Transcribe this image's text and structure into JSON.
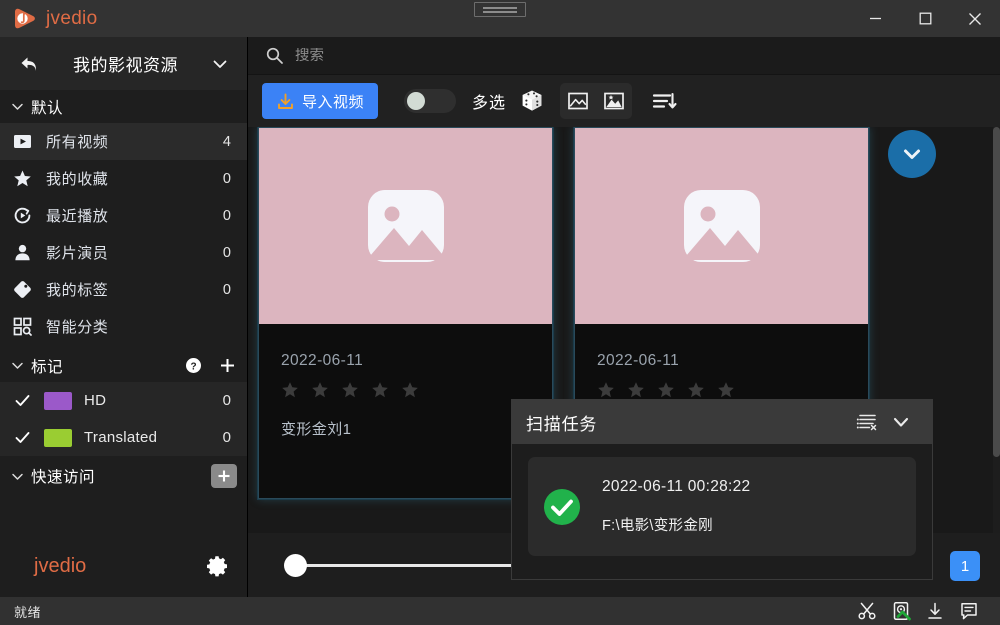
{
  "window": {
    "app_name": "jvedio",
    "logo_icon": "jvedio-play-logo-icon",
    "drag_handle_icon": "window-drag-handle-icon",
    "minimize_label": "–",
    "maximize_icon": "maximize-square-icon",
    "close_label": "✕"
  },
  "sidebar": {
    "back_icon": "back-arrow-icon",
    "title": "我的影视资源",
    "caret_icon": "chevron-down-icon",
    "default_group": {
      "label": "默认",
      "chevron_icon": "chevron-down-icon"
    },
    "items": [
      {
        "label": "所有视频",
        "count": "4",
        "icon": "play-rect-icon",
        "active": true
      },
      {
        "label": "我的收藏",
        "count": "0",
        "icon": "star-icon",
        "active": false
      },
      {
        "label": "最近播放",
        "count": "0",
        "icon": "recent-play-icon",
        "active": false
      },
      {
        "label": "影片演员",
        "count": "0",
        "icon": "person-icon",
        "active": false
      },
      {
        "label": "我的标签",
        "count": "0",
        "icon": "tag-icon",
        "active": false
      },
      {
        "label": "智能分类",
        "count": "",
        "icon": "smart-grid-search-icon",
        "active": false
      }
    ],
    "tags_group": {
      "label": "标记",
      "chevron_icon": "chevron-down-icon",
      "help_icon": "help-circle-icon",
      "add_icon": "plus-icon"
    },
    "tags": [
      {
        "name": "HD",
        "count": "0",
        "color": "#9b59c9",
        "check_icon": "check-icon"
      },
      {
        "name": "Translated",
        "count": "0",
        "color": "#9acd32",
        "check_icon": "check-icon"
      }
    ],
    "quick_group": {
      "label": "快速访问",
      "chevron_icon": "chevron-down-icon",
      "add_icon": "plus-box-icon"
    },
    "footer": {
      "logo": "jvedio",
      "settings_icon": "gear-icon"
    }
  },
  "search": {
    "icon": "search-icon",
    "placeholder": "搜索",
    "value": ""
  },
  "toolbar": {
    "import_label": "导入视频",
    "import_icon": "download-import-icon",
    "import_color": "#3b82f6",
    "toggle_icon": "toggle-switch-off-icon",
    "toggle_on": false,
    "multiselect_label": "多选",
    "random_icon": "dice-icon",
    "view_list_icon": "image-outline-icon",
    "view_grid_icon": "image-filled-icon",
    "sort_icon": "sort-descending-icon"
  },
  "content": {
    "scroll_down_icon": "chevron-down-circle-icon",
    "cards": [
      {
        "date": "2022-06-11",
        "title": "变形金刘1",
        "rating": 0,
        "max_rating": 5,
        "placeholder_icon": "image-placeholder-icon",
        "thumb_color": "#dcb5bf"
      },
      {
        "date": "2022-06-11",
        "title": "",
        "rating": 0,
        "max_rating": 5,
        "placeholder_icon": "image-placeholder-icon",
        "thumb_color": "#dcb5bf"
      }
    ],
    "zoom_slider": {
      "value": 0,
      "min": 0,
      "max": 100
    },
    "page_number": "1"
  },
  "scan_dialog": {
    "title": "扫描任务",
    "clear_icon": "clear-list-icon",
    "collapse_icon": "chevron-down-icon",
    "task": {
      "status_icon": "check-circle-success-icon",
      "status_color": "#21b24b",
      "timestamp": "2022-06-11 00:28:22",
      "path": "F:\\电影\\变形金刚"
    }
  },
  "statusbar": {
    "status_text": "就绪",
    "icons": [
      {
        "name": "scissors-icon"
      },
      {
        "name": "disk-check-icon"
      },
      {
        "name": "download-icon"
      },
      {
        "name": "message-icon"
      }
    ]
  }
}
